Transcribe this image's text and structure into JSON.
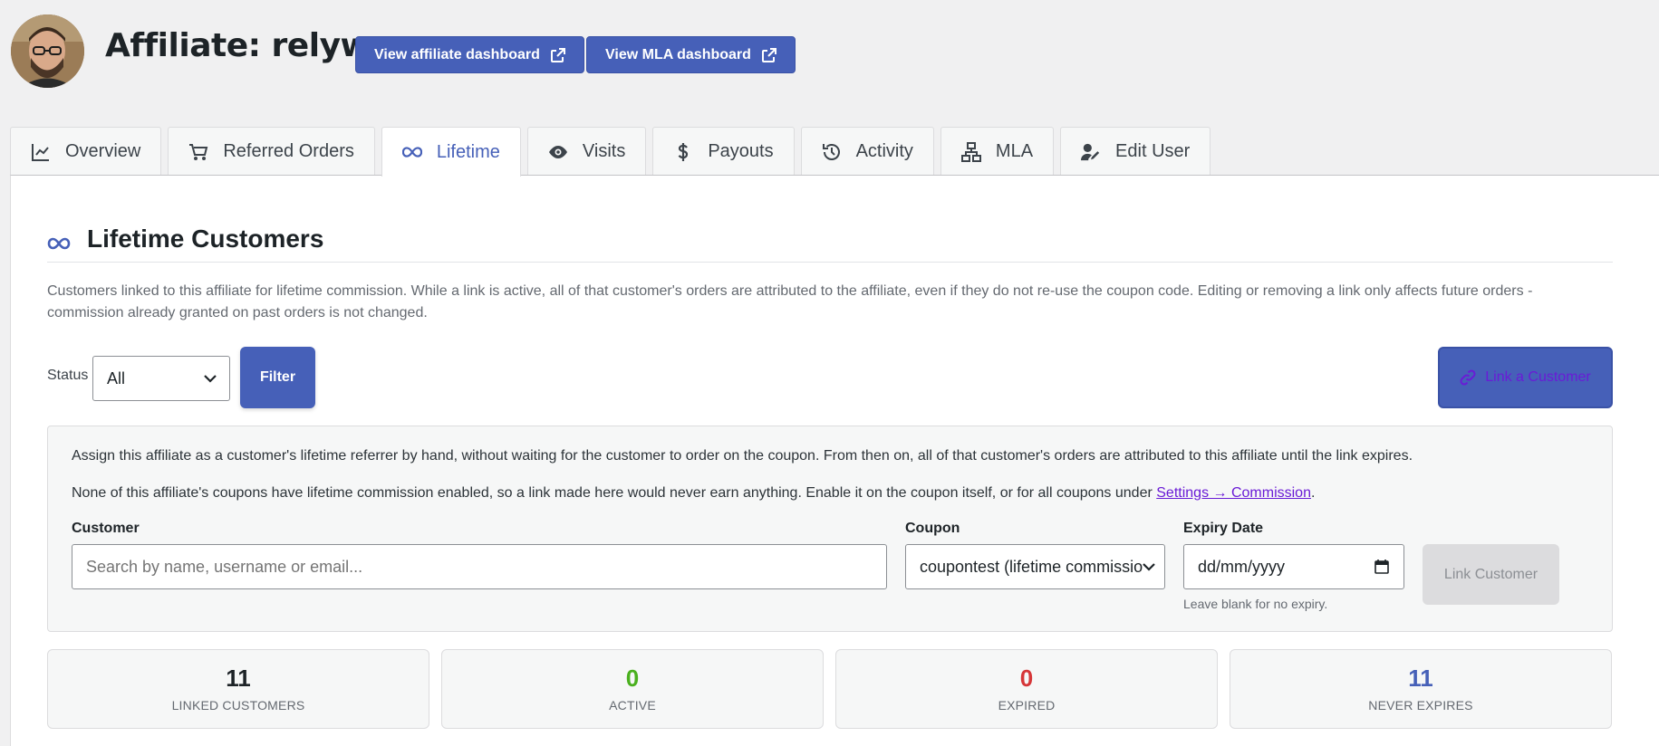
{
  "header": {
    "title": "Affiliate: relywp",
    "buttons": [
      {
        "label": "View affiliate dashboard",
        "icon": "external-link-icon"
      },
      {
        "label": "View MLA dashboard",
        "icon": "external-link-icon"
      }
    ]
  },
  "tabs": [
    {
      "label": "Overview",
      "icon": "chart-line-icon"
    },
    {
      "label": "Referred Orders",
      "icon": "cart-icon"
    },
    {
      "label": "Lifetime",
      "icon": "infinity-icon",
      "active": true
    },
    {
      "label": "Visits",
      "icon": "eye-icon"
    },
    {
      "label": "Payouts",
      "icon": "dollar-icon"
    },
    {
      "label": "Activity",
      "icon": "history-icon"
    },
    {
      "label": "MLA",
      "icon": "network-icon"
    },
    {
      "label": "Edit User",
      "icon": "user-edit-icon"
    }
  ],
  "section": {
    "title": "Lifetime Customers",
    "description": "Customers linked to this affiliate for lifetime commission. While a link is active, all of that customer's orders are attributed to the affiliate, even if they do not re-use the coupon code. Editing or removing a link only affects future orders - commission already granted on past orders is not changed."
  },
  "filter": {
    "status_label": "Status",
    "status_value": "All",
    "filter_button": "Filter",
    "link_customer_button": "Link a Customer"
  },
  "assign": {
    "paragraph1": "Assign this affiliate as a customer's lifetime referrer by hand, without waiting for the customer to order on the coupon. From then on, all of that customer's orders are attributed to this affiliate until the link expires.",
    "paragraph2_prefix": "None of this affiliate's coupons have lifetime commission enabled, so a link made here would never earn anything. Enable it on the coupon itself, or for all coupons under ",
    "paragraph2_link": "Settings → Commission",
    "paragraph2_suffix": ".",
    "customer_label": "Customer",
    "customer_placeholder": "Search by name, username or email...",
    "coupon_label": "Coupon",
    "coupon_value": "coupontest (lifetime commission)",
    "expiry_label": "Expiry Date",
    "expiry_placeholder": "dd/mm/yyyy",
    "expiry_hint": "Leave blank for no expiry.",
    "submit_button": "Link Customer"
  },
  "stats": [
    {
      "value": "11",
      "label": "LINKED CUSTOMERS",
      "color": "#1d2327"
    },
    {
      "value": "0",
      "label": "ACTIVE",
      "color": "#4ab01e"
    },
    {
      "value": "0",
      "label": "EXPIRED",
      "color": "#d63638"
    },
    {
      "value": "11",
      "label": "NEVER EXPIRES",
      "color": "#4660b8"
    }
  ],
  "colors": {
    "accent": "#4660b8",
    "link": "#6a1bd6"
  }
}
